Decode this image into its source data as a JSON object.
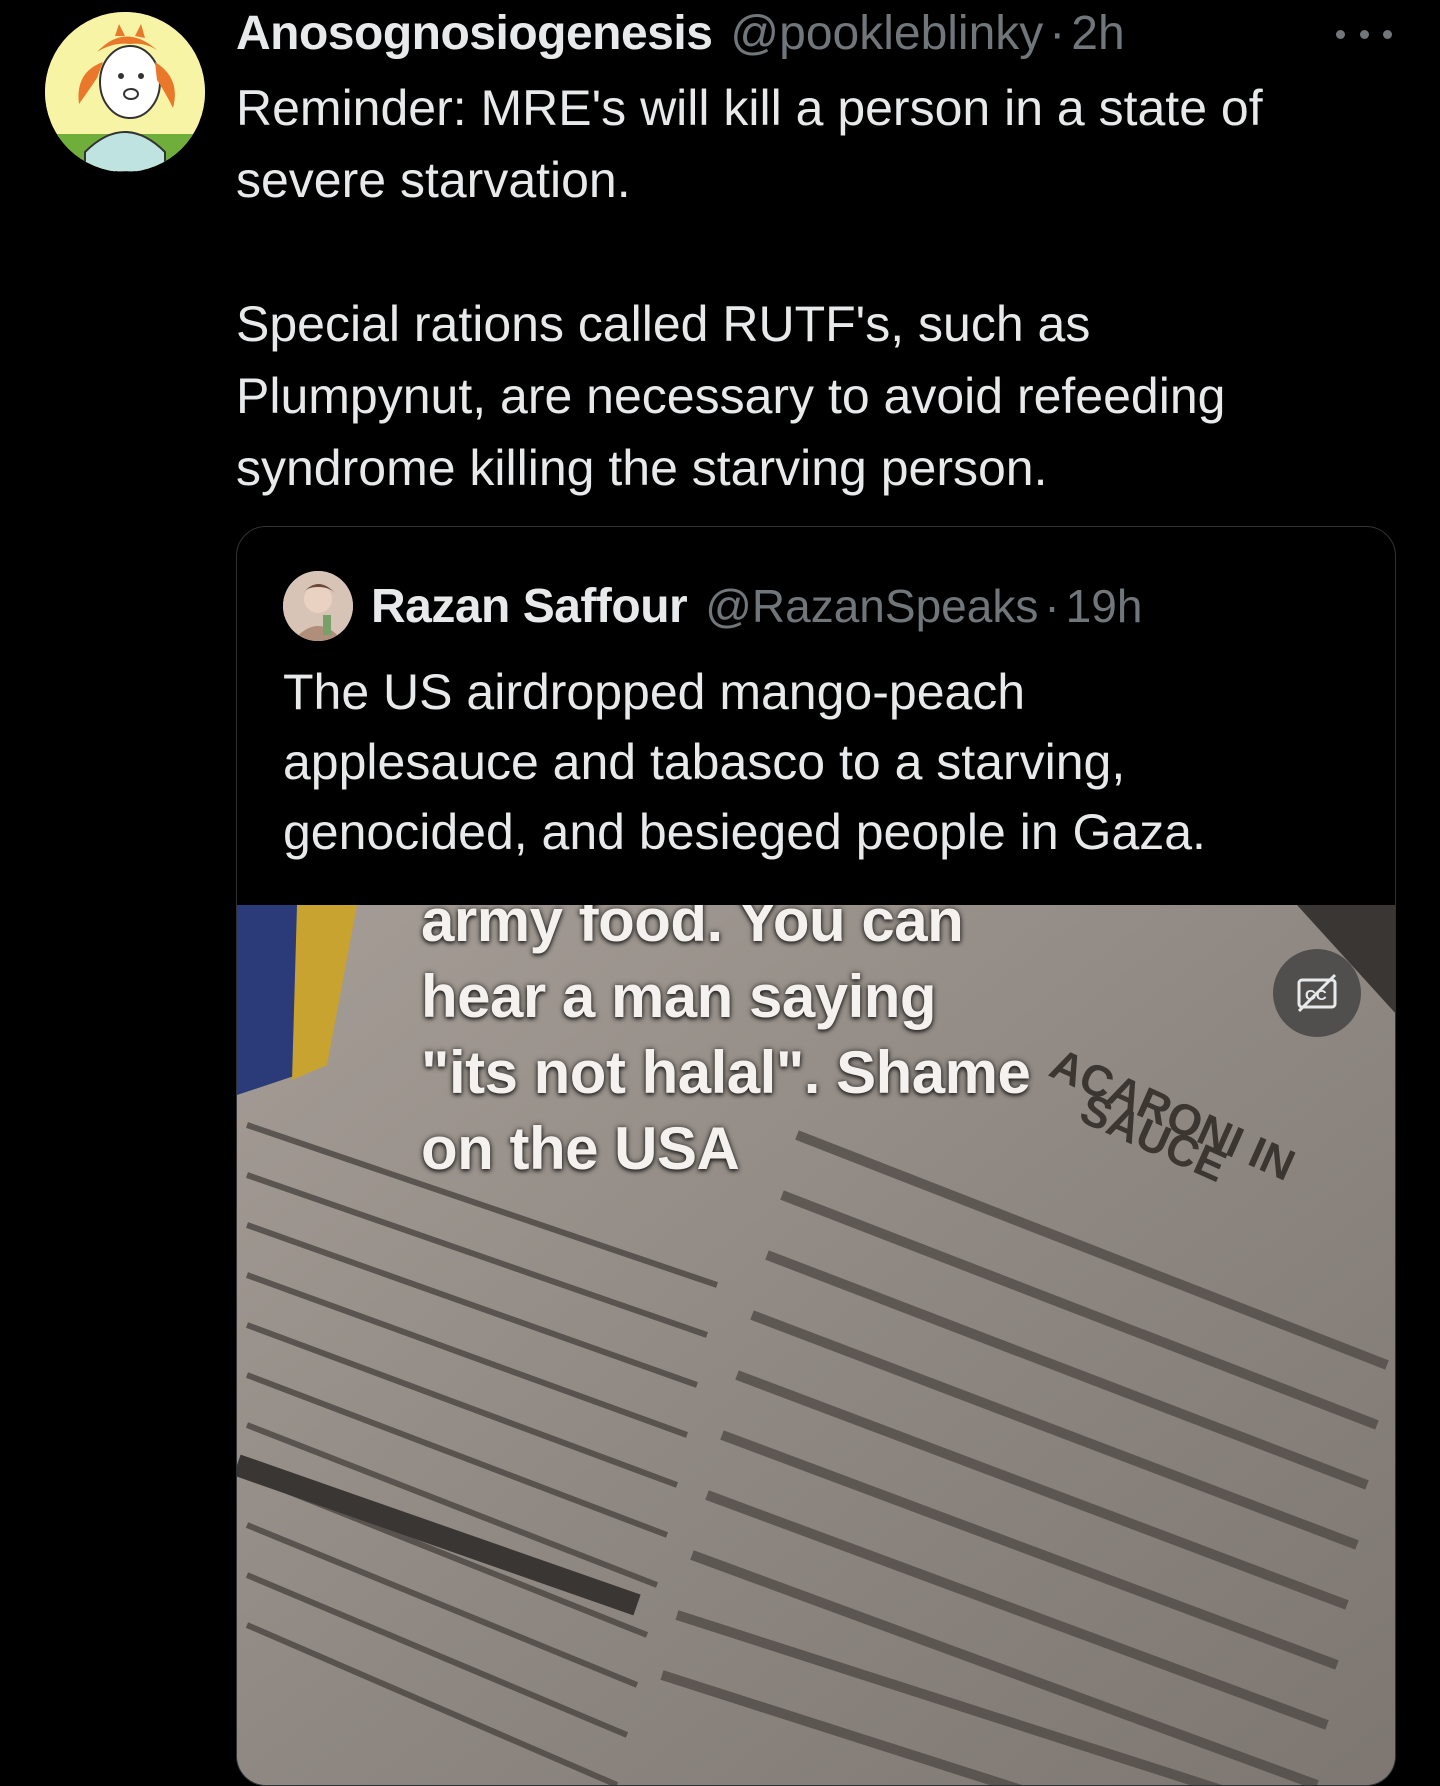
{
  "author": {
    "display_name": "Anosognosiogenesis",
    "handle": "@pookleblinky",
    "separator": "·",
    "time": "2h",
    "avatar_icon": "cartoon-avatar-icon"
  },
  "tweet": {
    "paragraphs": [
      [
        "Reminder: MRE's will kill a person in a state of",
        "severe starvation."
      ],
      [
        "Special rations called RUTF's, such as",
        "Plumpynut, are necessary to avoid refeeding",
        "syndrome killing the starving person."
      ]
    ]
  },
  "more_icon": "more-options-icon",
  "quoted": {
    "display_name": "Razan Saffour",
    "handle": "@RazanSpeaks",
    "separator": "·",
    "time": "19h",
    "lines": [
      "The US airdropped mango-peach",
      "applesauce and tabasco to a starving,",
      "genocided, and besieged people in Gaza."
    ],
    "media": {
      "caption_lines": [
        "army food. You can",
        "hear a man saying",
        "\"its not halal\". Shame",
        "on the USA"
      ],
      "package_text": [
        "ACARONI IN",
        "SAUCE"
      ],
      "cc_icon": "captions-off-icon"
    }
  },
  "colors": {
    "background": "#000000",
    "primary_text": "#e7e9ea",
    "secondary_text": "#71767b",
    "border": "#2f3336"
  }
}
